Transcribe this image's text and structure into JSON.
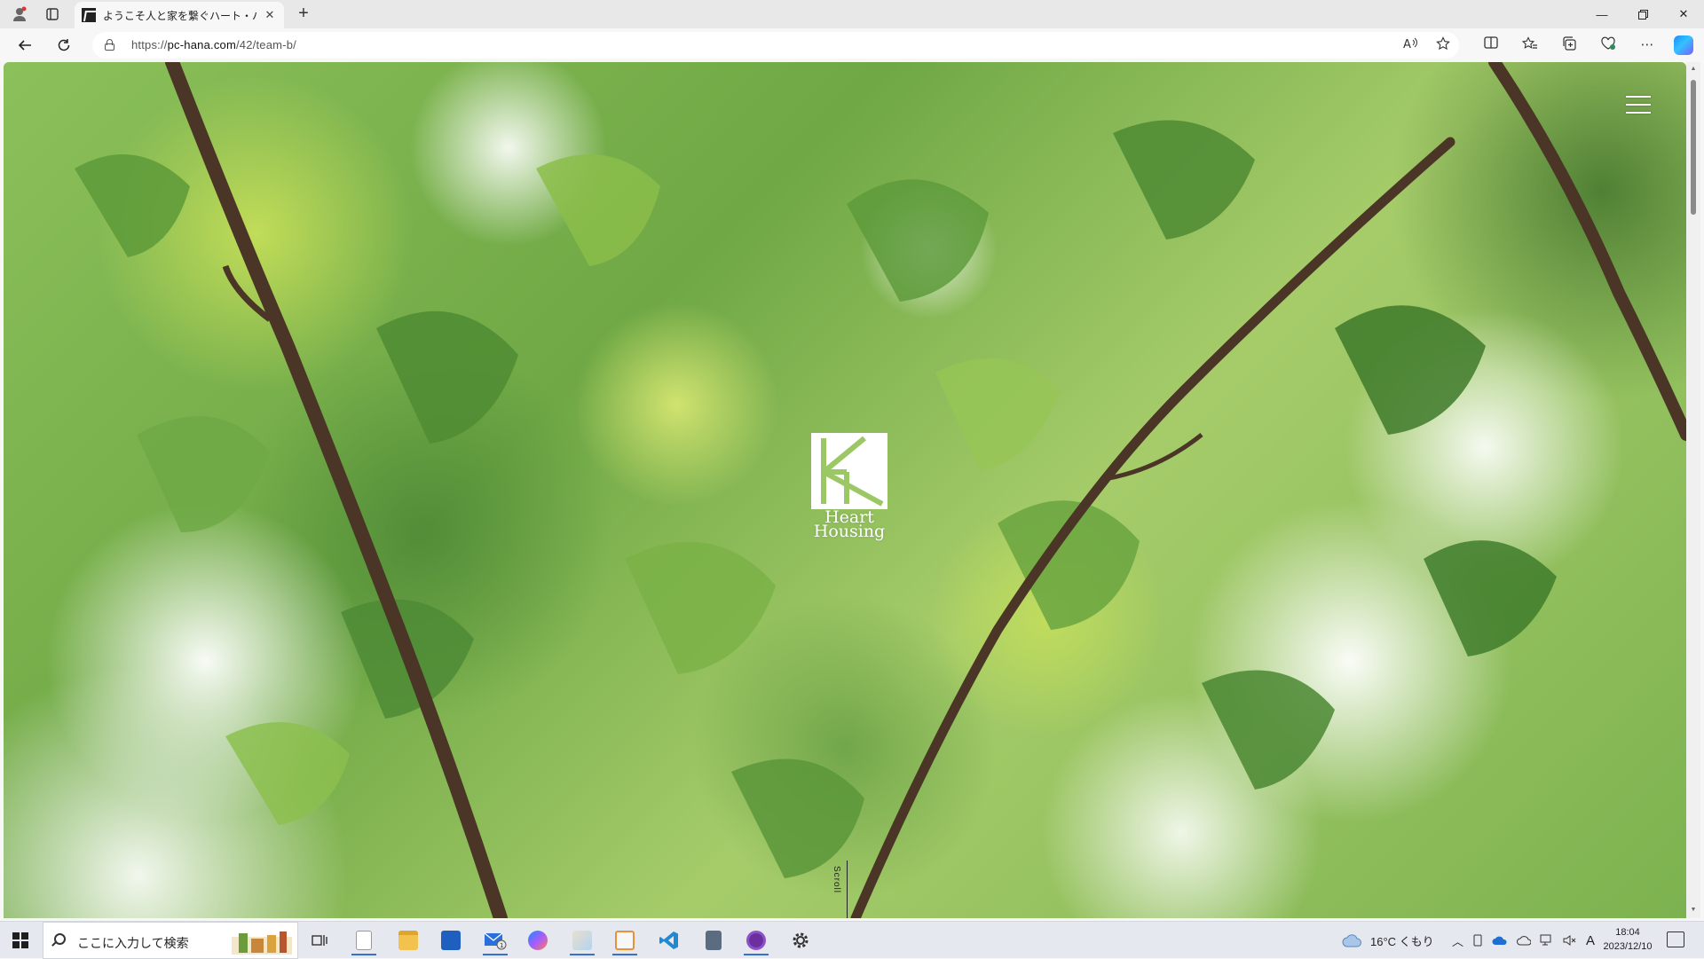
{
  "browser": {
    "tab": {
      "title": "ようこそ人と家を繋ぐハート・ハウジング"
    },
    "url": {
      "scheme": "https://",
      "host": "pc-hana.com",
      "path": "/42/team-b/"
    }
  },
  "site": {
    "logo_line1": "Heart",
    "logo_line2": "Housing",
    "scroll_label": "Scroll"
  },
  "taskbar": {
    "search_placeholder": "ここに入力して検索",
    "weather": "16°C くもり",
    "ime": "A",
    "time": "18:04",
    "date": "2023/12/10"
  }
}
